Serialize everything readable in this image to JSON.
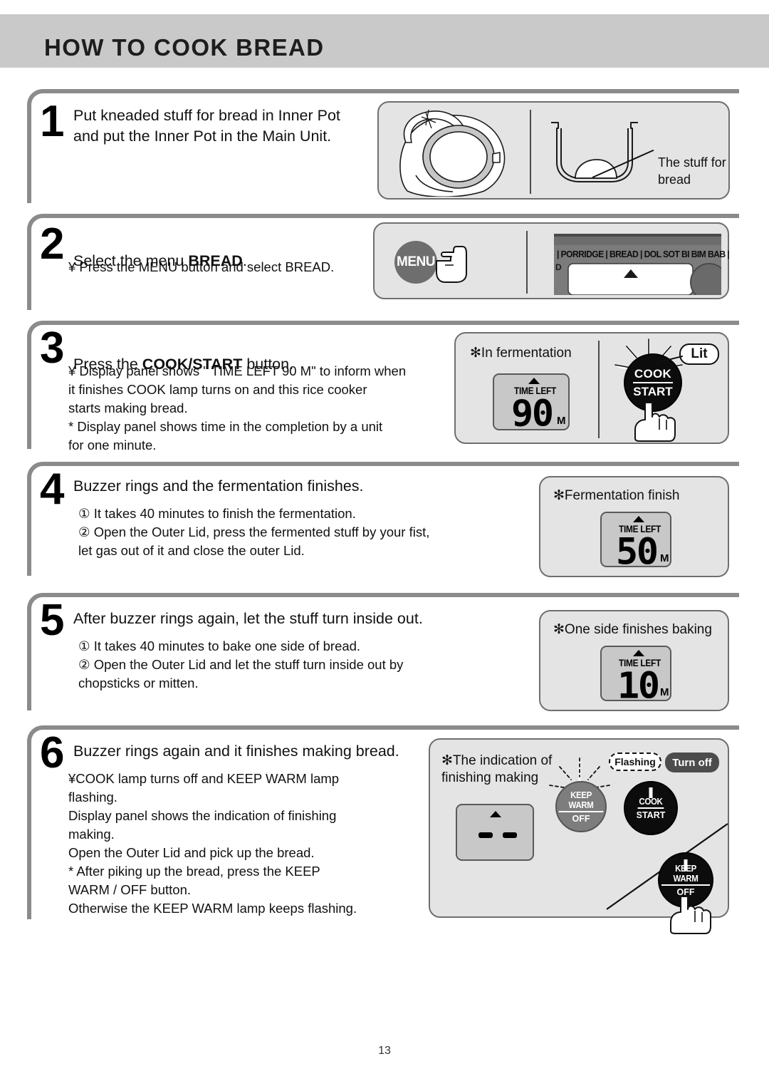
{
  "header": {
    "title": "HOW TO COOK BREAD"
  },
  "page_number": "13",
  "steps": [
    {
      "number": "1",
      "heading": "Put kneaded stuff for bread in Inner Pot\nand put the Inner Pot in the Main Unit.",
      "body": "",
      "illustration": {
        "label_stuff": "The stuff for\nbread"
      }
    },
    {
      "number": "2",
      "heading_pre": "Select the menu ",
      "heading_bold": "BREAD",
      "heading_post": ".",
      "body": "¥ Press the MENU button and select   BREAD.",
      "illustration": {
        "menu_button": "MENU",
        "lcd_menu_items": "| PORRIDGE | BREAD | DOL SOT BI BIM BAB |",
        "lcd_side_label": "D"
      }
    },
    {
      "number": "3",
      "heading_pre": "Press the ",
      "heading_bold": "COOK/START",
      "heading_post": " button.",
      "body": "¥ Display panel shows \" TIME LEFT 90 M\" to inform when\n   it finishes  COOK lamp turns on and this rice cooker\n   starts making bread.\n   * Display panel shows time in the completion by a unit\n      for one minute.",
      "illustration": {
        "caption": "✻In fermentation",
        "lcd_label": "TIME LEFT",
        "lcd_value": "90",
        "lcd_unit": "M",
        "button_line1": "COOK",
        "button_line2": "START",
        "callout": "Lit"
      }
    },
    {
      "number": "4",
      "heading": "Buzzer rings and the fermentation finishes.",
      "body": "① It takes 40 minutes to finish the fermentation.\n② Open the Outer Lid, press the fermented stuff by your fist,\n    let gas out of it and close the outer Lid.",
      "illustration": {
        "caption": "✻Fermentation finish",
        "lcd_label": "TIME LEFT",
        "lcd_value": "50",
        "lcd_unit": "M"
      }
    },
    {
      "number": "5",
      "heading": "After buzzer rings again, let the stuff turn inside out.",
      "body": "① It takes 40 minutes to bake one side of bread.\n② Open the Outer Lid and let the stuff turn inside out by\n    chopsticks or mitten.",
      "illustration": {
        "caption": "✻One side finishes baking",
        "lcd_label": "TIME LEFT",
        "lcd_value": "10",
        "lcd_unit": "M"
      }
    },
    {
      "number": "6",
      "heading": "Buzzer rings again and it finishes making bread.",
      "body": "¥COOK lamp turns off and   KEEP WARM lamp\n  flashing.\n  Display panel shows the indication of finishing\n  making.\n  Open the Outer Lid and pick up the bread.\n  * After piking up the bread, press the     KEEP\n    WARM / OFF button.\n     Otherwise the  KEEP WARM lamp keeps flashing.",
      "illustration": {
        "caption": "✻The indication of\n  finishing making",
        "keepwarm_line1": "KEEP WARM",
        "keepwarm_line2": "OFF",
        "cook_line1": "COOK",
        "cook_line2": "START",
        "callout_flashing": "Flashing",
        "callout_turnoff": "Turn off",
        "keepwarm2_line1": "KEEP WARM",
        "keepwarm2_line2": "OFF"
      }
    }
  ]
}
